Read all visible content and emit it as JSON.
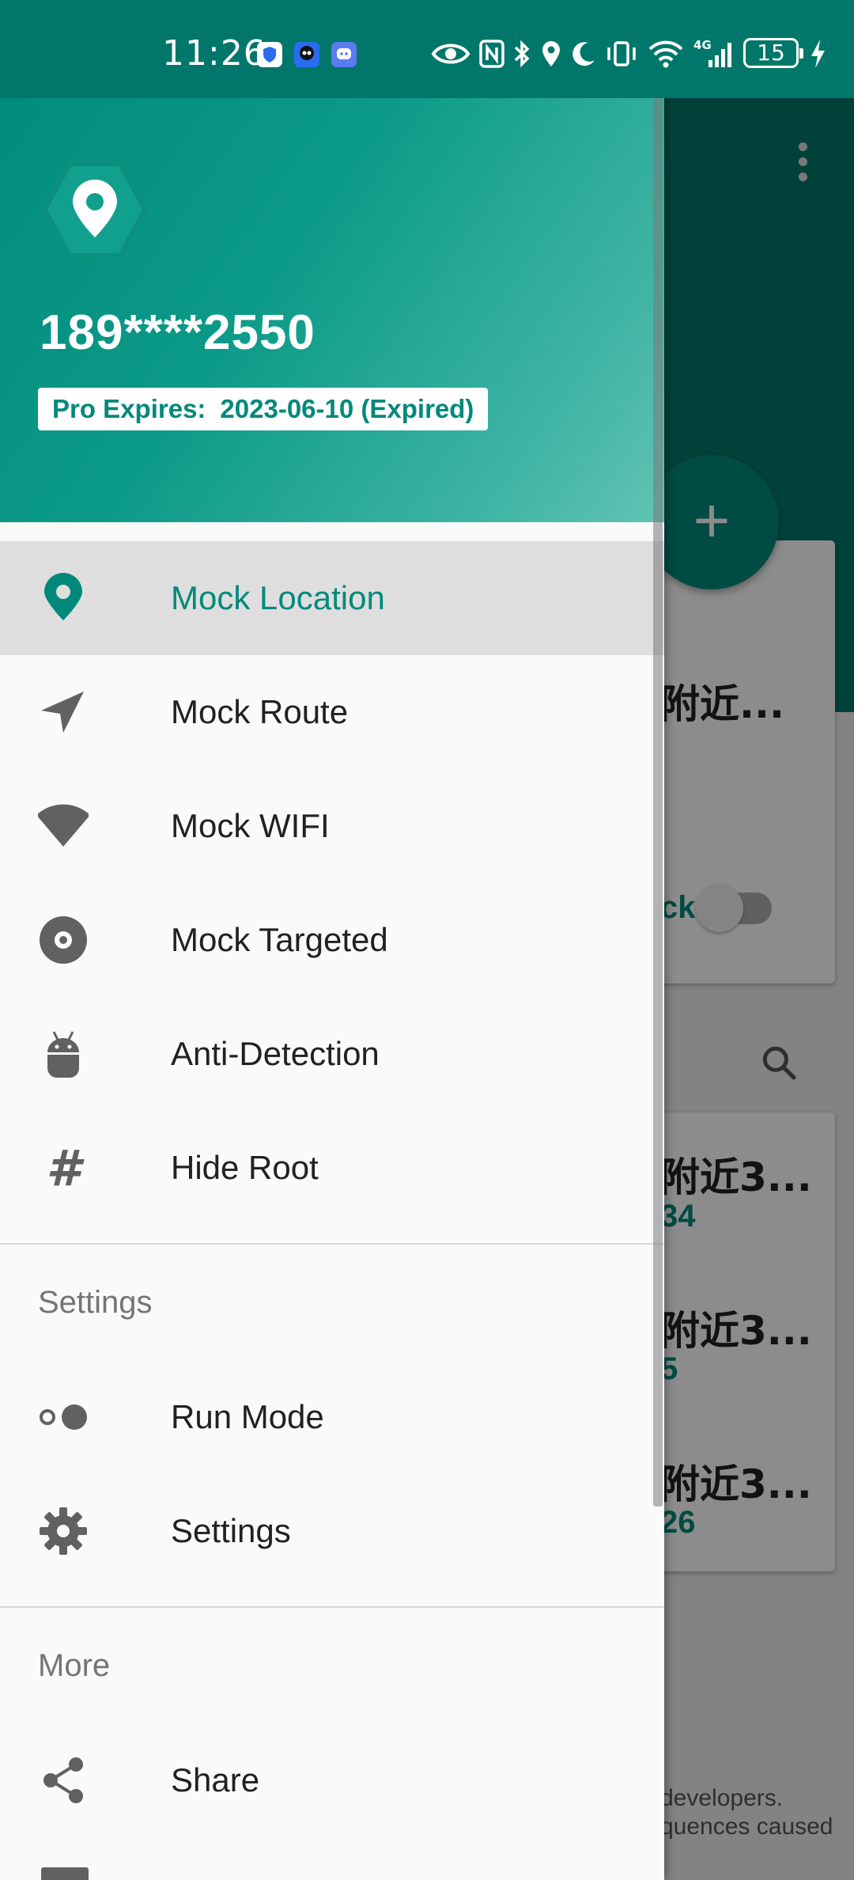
{
  "status_bar": {
    "time": "11:26",
    "battery": "15"
  },
  "drawer": {
    "header": {
      "phone": "189****2550",
      "pro_label": "Pro Expires:",
      "pro_value": "2023-06-10 (Expired)"
    },
    "main_items": [
      {
        "label": "Mock Location",
        "icon": "location-pin-icon",
        "active": true
      },
      {
        "label": "Mock Route",
        "icon": "navigation-arrow-icon"
      },
      {
        "label": "Mock WIFI",
        "icon": "wifi-icon"
      },
      {
        "label": "Mock Targeted",
        "icon": "target-disc-icon"
      },
      {
        "label": "Anti-Detection",
        "icon": "android-icon"
      },
      {
        "label": "Hide Root",
        "icon": "hashtag-icon"
      }
    ],
    "settings_section": {
      "title": "Settings",
      "items": [
        {
          "label": "Run Mode",
          "icon": "toggle-dots-icon"
        },
        {
          "label": "Settings",
          "icon": "gear-icon"
        }
      ]
    },
    "more_section": {
      "title": "More",
      "items": [
        {
          "label": "Share",
          "icon": "share-icon"
        }
      ]
    }
  },
  "background": {
    "card1_title": "附近...",
    "card1_toggle_label": "ck",
    "list": [
      {
        "title": "附近3...",
        "sub": "34"
      },
      {
        "title": "附近3...",
        "sub": "5"
      },
      {
        "title": "附近3...",
        "sub": "26"
      }
    ],
    "footer_line1": "developers.",
    "footer_line2": "quences caused"
  },
  "colors": {
    "primary": "#00897b",
    "status_bar": "#00776a",
    "active_item_bg": "#dedede"
  }
}
